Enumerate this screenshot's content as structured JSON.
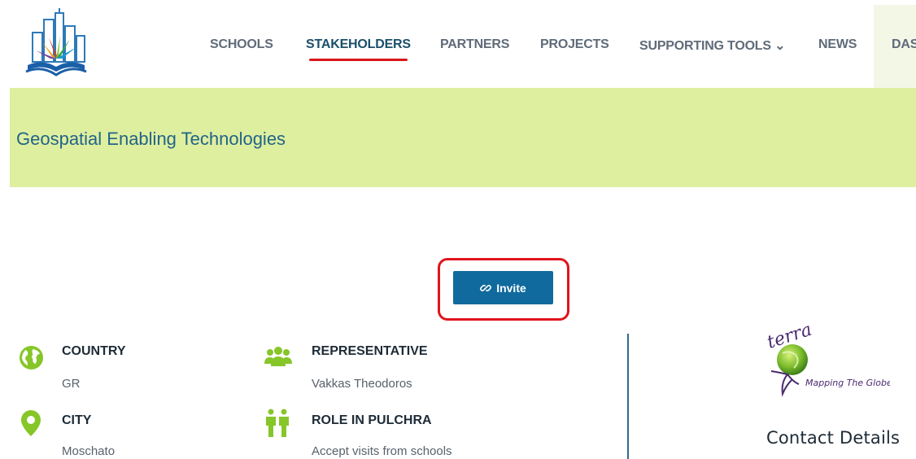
{
  "colors": {
    "nav_text": "#5f6b79",
    "active_text": "#1b4f6b",
    "active_underline": "#d9161c",
    "banner_bg": "#deef9f",
    "banner_text": "#226489",
    "button_bg": "#106a9d",
    "button_text": "#ffffff",
    "icon_green": "#86c628",
    "label_text": "#1d2b37",
    "value_text": "#57616b",
    "divider": "#2d6d8b"
  },
  "nav": {
    "items": [
      {
        "label": "SCHOOLS"
      },
      {
        "label": "STAKEHOLDERS",
        "active": true
      },
      {
        "label": "PARTNERS"
      },
      {
        "label": "PROJECTS"
      },
      {
        "label": "SUPPORTING TOOLS ⌄"
      },
      {
        "label": "NEWS"
      },
      {
        "label": "DAS"
      }
    ]
  },
  "banner": {
    "title": "Geospatial Enabling Technologies"
  },
  "invite": {
    "label": "Invite",
    "icon": "link-icon"
  },
  "details": [
    {
      "label": "COUNTRY",
      "value": "GR",
      "icon": "globe-icon"
    },
    {
      "label": "CITY",
      "value": "Moschato",
      "icon": "map-pin-icon"
    },
    {
      "label": "REPRESENTATIVE",
      "value": "Vakkas Theodoros",
      "icon": "group-icon"
    },
    {
      "label": "ROLE IN PULCHRA",
      "value": "Accept visits from schools",
      "icon": "people-icon"
    }
  ],
  "sidebar": {
    "logo_word": "terra",
    "logo_tagline": "Mapping The Globe",
    "contact_title": "Contact Details"
  }
}
